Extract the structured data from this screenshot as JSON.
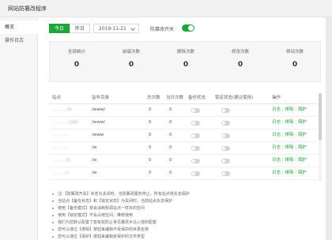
{
  "window": {
    "title": "网站防篡改程序"
  },
  "sidebar": {
    "items": [
      {
        "label": "概览"
      },
      {
        "label": "操作日志"
      }
    ]
  },
  "toolbar": {
    "today": "今日",
    "yesterday": "昨日",
    "date": "2019-11-21",
    "switch_label": "防篡改开关",
    "switch_on": true
  },
  "stats": [
    {
      "label": "全部统计",
      "value": "0"
    },
    {
      "label": "前缀次数",
      "value": "0"
    },
    {
      "label": "删除次数",
      "value": "0"
    },
    {
      "label": "修改次数",
      "value": "0"
    },
    {
      "label": "移动次数",
      "value": "0"
    }
  ],
  "table": {
    "headers": [
      "站点",
      "监听目录",
      "总次数",
      "当日次数",
      "备份状态",
      "锁定状态(建议使用)",
      "操作"
    ],
    "rows": [
      {
        "site": "...........m",
        "dir": "/www/",
        "total": "0",
        "today": "0",
        "ops": [
          "日志",
          "排除",
          "保护"
        ]
      },
      {
        "site": "............com",
        "dir": "/www/",
        "total": "0",
        "today": "0",
        "ops": [
          "日志",
          "排除",
          "保护"
        ]
      },
      {
        "site": "............",
        "dir": "/www",
        "total": "0",
        "today": "0",
        "ops": [
          "日志",
          "排除",
          "保护"
        ]
      },
      {
        "site": "............",
        "dir": "/w",
        "total": "0",
        "today": "0",
        "ops": [
          "日志",
          "排除",
          "保护"
        ]
      },
      {
        "site": "..........m",
        "dir": "/w",
        "total": "0",
        "today": "0",
        "ops": [
          "日志",
          "排除",
          "保护"
        ]
      },
      {
        "site": "..........n",
        "dir": "/w",
        "total": "0",
        "today": "0",
        "ops": [
          "日志",
          "排除",
          "保护"
        ]
      },
      {
        "site": "...........",
        "dir": "/w",
        "total": "0",
        "today": "0",
        "ops": [
          "日志",
          "排除",
          "保护"
        ]
      }
    ]
  },
  "notes": [
    "注:【防篡改开关】状态为关闭时，当防篡改服务停止，所有站点将失去保护",
    "当站点【备份状态】和【锁定状态】为关闭时，当前站点失去保护",
    "使用【备份模式】将会消耗和源站点一样多的空间",
    "使用【锁定模式】不会占用空间，推荐使用",
    "我们为您默认配置了能有效防止常见篡改木马入侵的配置",
    "您可以通过【排除】按钮来编辑不受保护的目录名称",
    "您可以通过【保护】按钮来编辑受保护的文件类型"
  ],
  "colors": {
    "accent": "#20a53a"
  }
}
